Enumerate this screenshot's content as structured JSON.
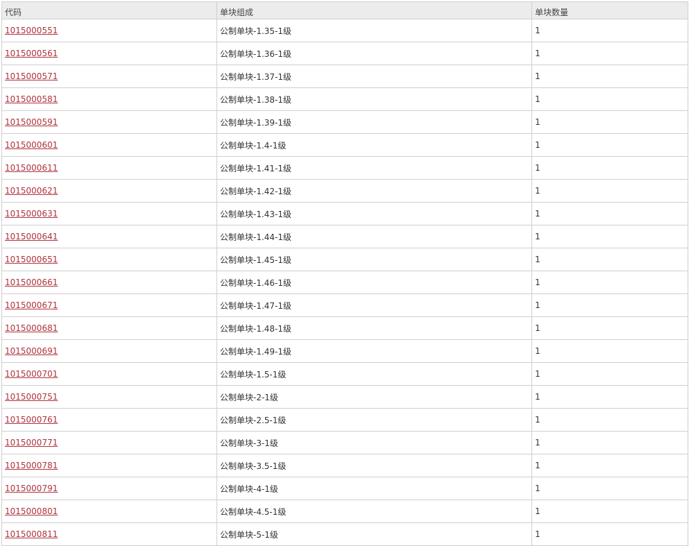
{
  "table": {
    "headers": [
      "代码",
      "单块组成",
      "单块数量"
    ],
    "rows": [
      {
        "code": "1015000551",
        "composition": "公制单块-1.35-1级",
        "quantity": "1"
      },
      {
        "code": "1015000561",
        "composition": "公制单块-1.36-1级",
        "quantity": "1"
      },
      {
        "code": "1015000571",
        "composition": "公制单块-1.37-1级",
        "quantity": "1"
      },
      {
        "code": "1015000581",
        "composition": "公制单块-1.38-1级",
        "quantity": "1"
      },
      {
        "code": "1015000591",
        "composition": "公制单块-1.39-1级",
        "quantity": "1"
      },
      {
        "code": "1015000601",
        "composition": "公制单块-1.4-1级",
        "quantity": "1"
      },
      {
        "code": "1015000611",
        "composition": "公制单块-1.41-1级",
        "quantity": "1"
      },
      {
        "code": "1015000621",
        "composition": "公制单块-1.42-1级",
        "quantity": "1"
      },
      {
        "code": "1015000631",
        "composition": "公制单块-1.43-1级",
        "quantity": "1"
      },
      {
        "code": "1015000641",
        "composition": "公制单块-1.44-1级",
        "quantity": "1"
      },
      {
        "code": "1015000651",
        "composition": "公制单块-1.45-1级",
        "quantity": "1"
      },
      {
        "code": "1015000661",
        "composition": "公制单块-1.46-1级",
        "quantity": "1"
      },
      {
        "code": "1015000671",
        "composition": "公制单块-1.47-1级",
        "quantity": "1"
      },
      {
        "code": "1015000681",
        "composition": "公制单块-1.48-1级",
        "quantity": "1"
      },
      {
        "code": "1015000691",
        "composition": "公制单块-1.49-1级",
        "quantity": "1"
      },
      {
        "code": "1015000701",
        "composition": "公制单块-1.5-1级",
        "quantity": "1"
      },
      {
        "code": "1015000751",
        "composition": "公制单块-2-1级",
        "quantity": "1"
      },
      {
        "code": "1015000761",
        "composition": "公制单块-2.5-1级",
        "quantity": "1"
      },
      {
        "code": "1015000771",
        "composition": "公制单块-3-1级",
        "quantity": "1"
      },
      {
        "code": "1015000781",
        "composition": "公制单块-3.5-1级",
        "quantity": "1"
      },
      {
        "code": "1015000791",
        "composition": "公制单块-4-1级",
        "quantity": "1"
      },
      {
        "code": "1015000801",
        "composition": "公制单块-4.5-1级",
        "quantity": "1"
      },
      {
        "code": "1015000811",
        "composition": "公制单块-5-1级",
        "quantity": "1"
      }
    ]
  },
  "colors": {
    "link": "#b0303c",
    "header_bg": "#ececec",
    "border": "#cfcfcf",
    "text": "#333333"
  }
}
